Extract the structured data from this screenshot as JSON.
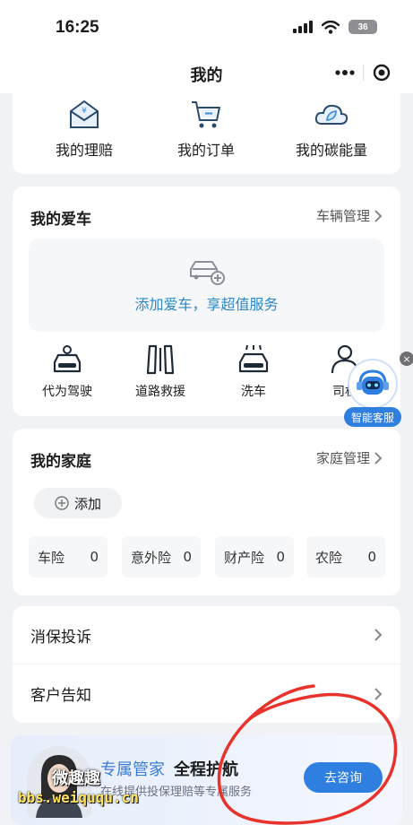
{
  "status_bar": {
    "time": "16:25",
    "battery": "36"
  },
  "nav": {
    "title": "我的"
  },
  "quick_actions": [
    {
      "label": "我的理赔",
      "icon": "claim-envelope-icon"
    },
    {
      "label": "我的订单",
      "icon": "cart-icon"
    },
    {
      "label": "我的碳能量",
      "icon": "leaf-cloud-icon"
    }
  ],
  "my_car": {
    "title": "我的爱车",
    "manage_link": "车辆管理",
    "add_car_text": "添加爱车，享超值服务",
    "services": [
      {
        "label": "代为驾驶",
        "icon": "driver-car-icon"
      },
      {
        "label": "道路救援",
        "icon": "road-icon"
      },
      {
        "label": "洗车",
        "icon": "car-wash-icon"
      },
      {
        "label": "司机",
        "icon": "driver-person-icon"
      }
    ]
  },
  "family": {
    "title": "我的家庭",
    "manage_link": "家庭管理",
    "add_label": "添加",
    "insurances": [
      {
        "label": "车险",
        "count": "0"
      },
      {
        "label": "意外险",
        "count": "0"
      },
      {
        "label": "财产险",
        "count": "0"
      },
      {
        "label": "农险",
        "count": "0"
      }
    ]
  },
  "list": [
    {
      "label": "消保投诉"
    },
    {
      "label": "客户告知"
    }
  ],
  "banner": {
    "line1_a": "专属管家",
    "line1_b": "全程护航",
    "line2": "在线提供投保理赔等专属服务",
    "button": "去咨询"
  },
  "ai_service": {
    "label": "智能客服"
  },
  "watermark": {
    "line1": "微趣趣",
    "line2": "bbs.weiququ.cn"
  },
  "colors": {
    "accent": "#2f7fe0",
    "link_blue": "#2b87c9",
    "annotation_red": "#e8322b"
  }
}
